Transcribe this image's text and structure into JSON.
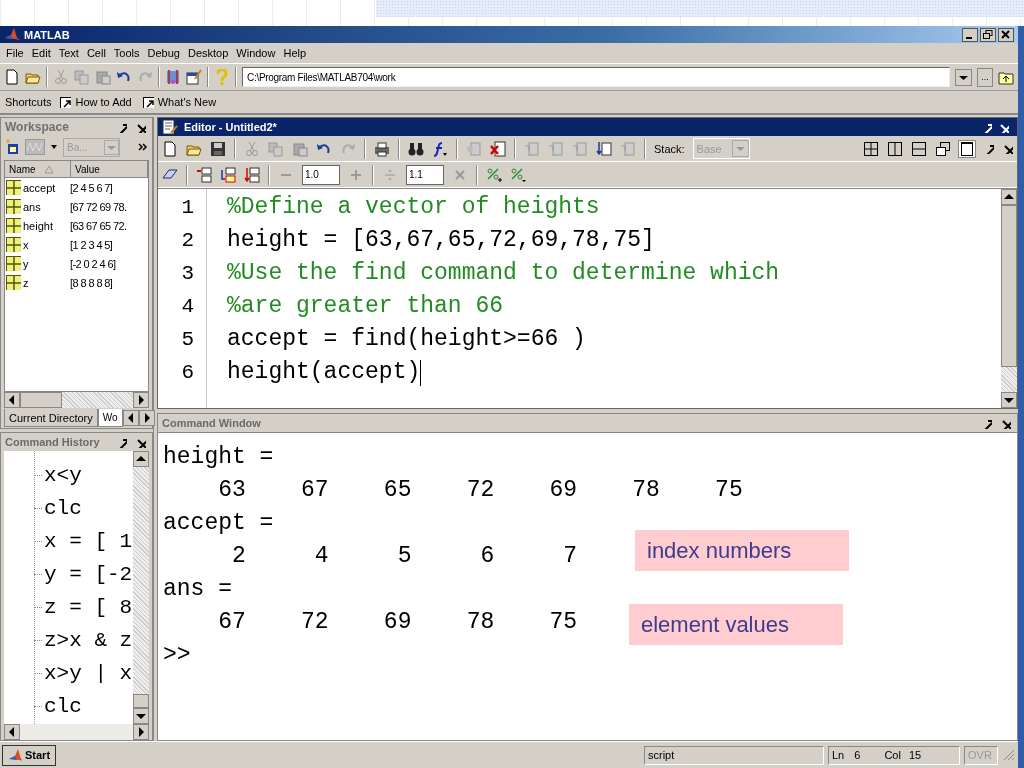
{
  "window": {
    "title": "MATLAB"
  },
  "menu": [
    "File",
    "Edit",
    "Text",
    "Cell",
    "Tools",
    "Debug",
    "Desktop",
    "Window",
    "Help"
  ],
  "toolbar": {
    "current_directory": "C:\\Program Files\\MATLAB704\\work",
    "browse": "..."
  },
  "shortcuts": {
    "label": "Shortcuts",
    "items": [
      "How to Add",
      "What's New"
    ]
  },
  "workspace": {
    "title": "Workspace",
    "stack": "Ba...",
    "columns": [
      "Name",
      "Value"
    ],
    "rows": [
      {
        "name": "accept",
        "value": "[2 4 5 6 7]"
      },
      {
        "name": "ans",
        "value": "[67 72 69 78."
      },
      {
        "name": "height",
        "value": "[63 67 65 72."
      },
      {
        "name": "x",
        "value": "[1 2 3 4 5]"
      },
      {
        "name": "y",
        "value": "[-2 0 2 4 6]"
      },
      {
        "name": "z",
        "value": "[8 8 8 8 8]"
      }
    ],
    "tabs": [
      {
        "label": "Current Directory",
        "selected": false
      },
      {
        "label": "Wo",
        "selected": true
      }
    ]
  },
  "command_history": {
    "title": "Command History",
    "items": [
      "x<y",
      "clc",
      "x = [ 1",
      "y = [-2",
      "z = [ 8",
      "z>x & z",
      "x>y | x",
      "clc"
    ]
  },
  "editor": {
    "title": "Editor - Untitled2*",
    "stack_label": "Stack:",
    "stack_value": "Base",
    "decrement_field": "1.0",
    "divide_field": "1.1",
    "lines": [
      {
        "number": "1",
        "text": "%Define a vector of heights",
        "kind": "comment"
      },
      {
        "number": "2",
        "text": "height = [63,67,65,72,69,78,75]",
        "kind": "code"
      },
      {
        "number": "3",
        "text": "%Use the find command to determine which",
        "kind": "comment"
      },
      {
        "number": "4",
        "text": "%are greater than 66",
        "kind": "comment"
      },
      {
        "number": "5",
        "text": "accept = find(height>=66 )",
        "kind": "code"
      },
      {
        "number": "6",
        "text": "height(accept)",
        "kind": "code"
      }
    ]
  },
  "command_window": {
    "title": "Command Window",
    "lines": [
      "height =",
      "    63    67    65    72    69    78    75",
      "accept =",
      "     2     4     5     6     7",
      "ans =",
      "    67    72    69    78    75",
      ">>"
    ]
  },
  "callouts": [
    {
      "text": "index numbers"
    },
    {
      "text": "element values"
    }
  ],
  "status_bar": {
    "start": "Start",
    "mode": "script",
    "line_label": "Ln",
    "line": "6",
    "col_label": "Col",
    "col": "15",
    "overwrite": "OVR"
  }
}
